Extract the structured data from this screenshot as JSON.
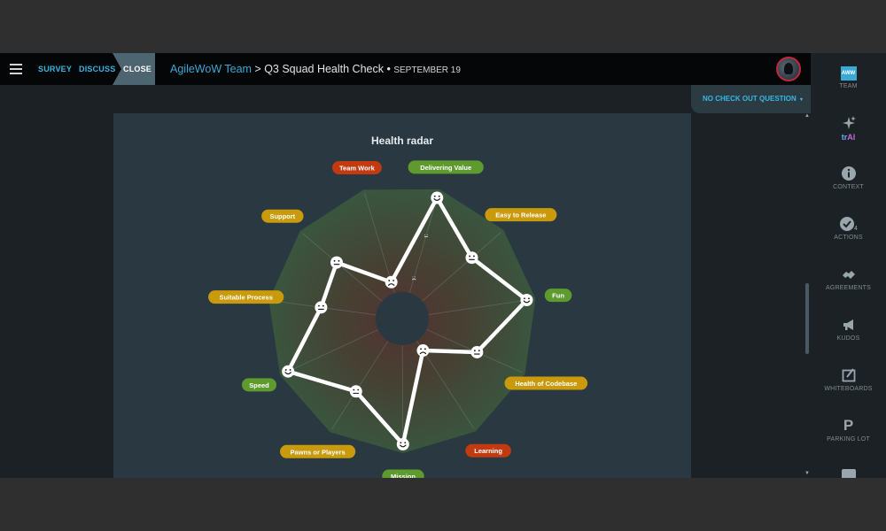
{
  "topbar": {
    "steps": [
      "SURVEY",
      "DISCUSS",
      "CLOSE"
    ],
    "team": "AgileWoW Team",
    "separator": " > ",
    "title": "Q3 Squad Health Check",
    "bullet": " • ",
    "date": "SEPTEMBER 19"
  },
  "checkout": {
    "label": "NO CHECK OUT QUESTION",
    "caret": "▾"
  },
  "radar": {
    "title": "Health radar",
    "categories": [
      {
        "label": "Delivering Value",
        "color": "#5e9a2e",
        "score": 1.0,
        "face": "happy"
      },
      {
        "label": "Easy to Release",
        "color": "#c99a0b",
        "score": 0.62,
        "face": "neutral"
      },
      {
        "label": "Fun",
        "color": "#5e9a2e",
        "score": 1.0,
        "face": "happy"
      },
      {
        "label": "Health of Codebase",
        "color": "#c99a0b",
        "score": 0.5,
        "face": "neutral"
      },
      {
        "label": "Learning",
        "color": "#c23a10",
        "score": 0.0,
        "face": "sad"
      },
      {
        "label": "Mission",
        "color": "#5e9a2e",
        "score": 1.0,
        "face": "happy"
      },
      {
        "label": "Pawns or Players",
        "color": "#c99a0b",
        "score": 0.55,
        "face": "neutral"
      },
      {
        "label": "Speed",
        "color": "#5e9a2e",
        "score": 1.0,
        "face": "happy"
      },
      {
        "label": "Suitable Process",
        "color": "#c99a0b",
        "score": 0.5,
        "face": "neutral"
      },
      {
        "label": "Support",
        "color": "#c99a0b",
        "score": 0.55,
        "face": "neutral"
      },
      {
        "label": "Team Work",
        "color": "#c23a10",
        "score": 0.0,
        "face": "sad"
      }
    ],
    "ghost_marks": [
      {
        "category": "Delivering Value",
        "score": 0.55,
        "face": "neutral"
      },
      {
        "category": "Delivering Value",
        "score": 0.05,
        "face": "sad"
      }
    ]
  },
  "sidebar": {
    "team_logo": "AWW",
    "team_label": "TEAM",
    "trai_prefix": "tr",
    "trai_suffix": "AI",
    "context": "CONTEXT",
    "actions": "ACTIONS",
    "actions_badge": "4",
    "agreements": "AGREEMENTS",
    "kudos": "KUDOS",
    "whiteboards": "WHITEBOARDS",
    "parking_glyph": "P",
    "parking": "PARKING LOT"
  },
  "scroll": {
    "up": "▲",
    "down": "▼"
  }
}
